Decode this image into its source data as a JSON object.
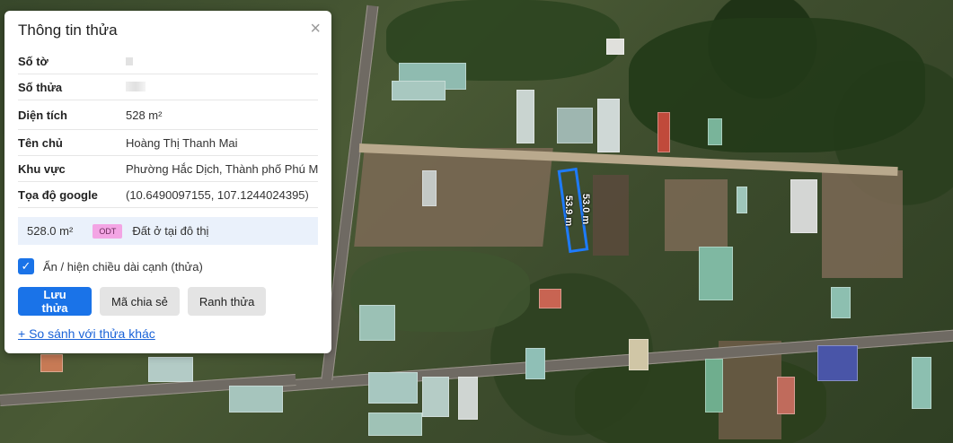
{
  "panel": {
    "title": "Thông tin thửa",
    "close_icon": "×",
    "fields": [
      {
        "label": "Số tờ",
        "value": ""
      },
      {
        "label": "Số thửa",
        "value": ""
      },
      {
        "label": "Diện tích",
        "value": "528 m²"
      },
      {
        "label": "Tên chủ",
        "value": "Hoàng Thị Thanh Mai"
      },
      {
        "label": "Khu vực",
        "value": "Phường Hắc Dịch, Thành phố Phú Mỹ"
      },
      {
        "label": "Tọa độ google",
        "value": "(10.6490097155, 107.1244024395)"
      }
    ],
    "land_use": {
      "area": "528.0 m²",
      "code": "ODT",
      "type": "Đất ở tại đô thị"
    },
    "toggle_label": "Ẩn / hiện chiều dài cạnh (thửa)",
    "toggle_checked": true,
    "buttons": {
      "save": "Lưu thửa",
      "share": "Mã chia sẻ",
      "boundary": "Ranh thửa"
    },
    "compare_link": "+ So sánh với thửa khác"
  },
  "map": {
    "edge_label_a": "53.9 m",
    "edge_label_b": "53.0 m",
    "parcel_color": "#1e7bff"
  }
}
